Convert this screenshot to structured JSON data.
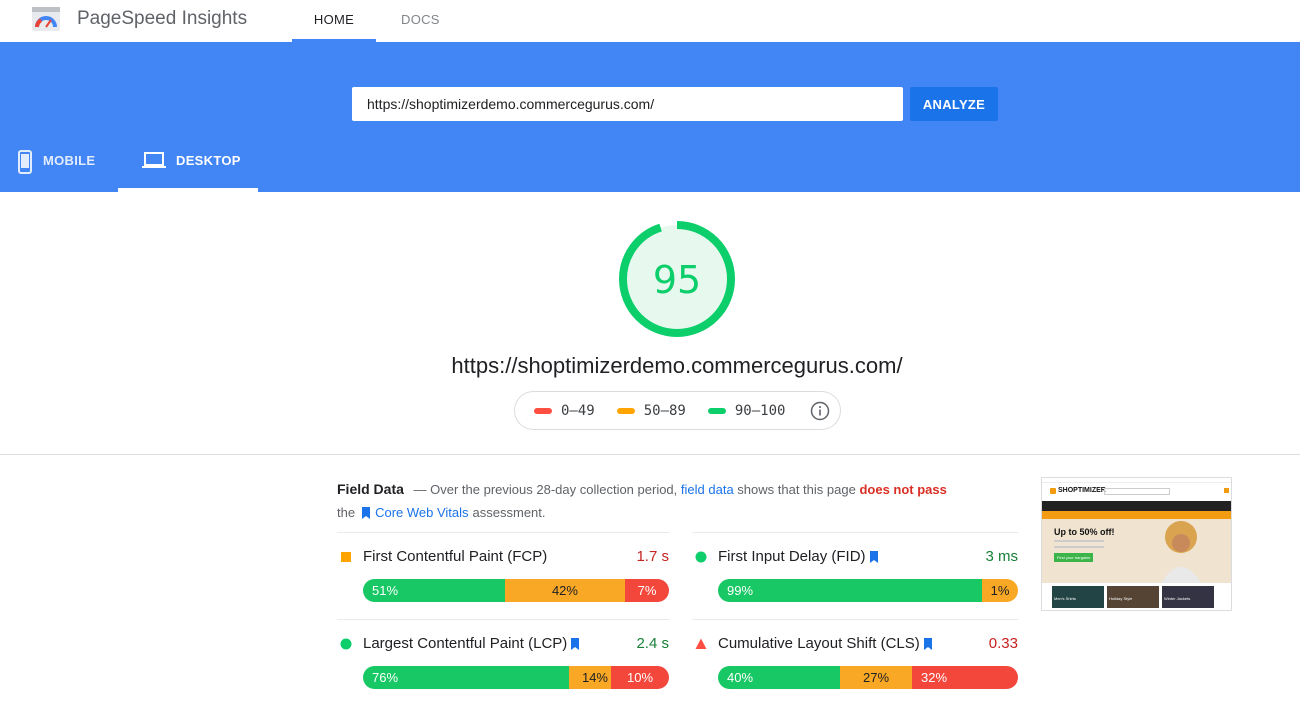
{
  "app": {
    "title": "PageSpeed Insights"
  },
  "nav": {
    "home_label": "HOME",
    "docs_label": "DOCS"
  },
  "search": {
    "url": "https://shoptimizerdemo.commercegurus.com/",
    "analyze_label": "ANALYZE"
  },
  "device_tabs": {
    "mobile_label": "MOBILE",
    "desktop_label": "DESKTOP",
    "active": "desktop"
  },
  "score": {
    "value": "95",
    "fraction": 0.95,
    "color": "#0cce6b"
  },
  "report_url": "https://shoptimizerdemo.commercegurus.com/",
  "legend": {
    "fail": "0–49",
    "average": "50–89",
    "pass": "90–100",
    "fail_color": "#ff4e42",
    "average_color": "#ffa400",
    "pass_color": "#0cce6b"
  },
  "field_data": {
    "title": "Field Data",
    "desc_part1": "— Over the previous 28-day collection period,",
    "field_data_link": "field data",
    "desc_part2": "shows that this page",
    "verdict": "does not pass",
    "desc_part3": "the",
    "cwv_link": "Core Web Vitals",
    "desc_part4": "assessment."
  },
  "metrics": {
    "fcp": {
      "name": "First Contentful Paint (FCP)",
      "value": "1.7 s",
      "status": "average",
      "good": "51%",
      "ni": "42%",
      "poor": "7%",
      "g": 51,
      "n": 42,
      "p": 7
    },
    "fid": {
      "name": "First Input Delay (FID)",
      "value": "3 ms",
      "status": "pass",
      "good": "99%",
      "ni": "1%",
      "poor": "",
      "g": 99,
      "n": 1,
      "p": 0
    },
    "lcp": {
      "name": "Largest Contentful Paint (LCP)",
      "value": "2.4 s",
      "status": "pass",
      "good": "76%",
      "ni": "14%",
      "poor": "10%",
      "g": 76,
      "n": 14,
      "p": 10
    },
    "cls": {
      "name": "Cumulative Layout Shift (CLS)",
      "value": "0.33",
      "status": "fail",
      "good": "40%",
      "ni": "27%",
      "poor": "32%",
      "g": 40,
      "n": 27,
      "p": 32
    }
  },
  "thumbnail": {
    "brand": "SHOPTIMIZER",
    "headline": "Up to 50% off!",
    "button": "Find your bargains",
    "tiles": [
      "Men's Shirts",
      "Holiday Style",
      "Winter Jackets"
    ]
  }
}
